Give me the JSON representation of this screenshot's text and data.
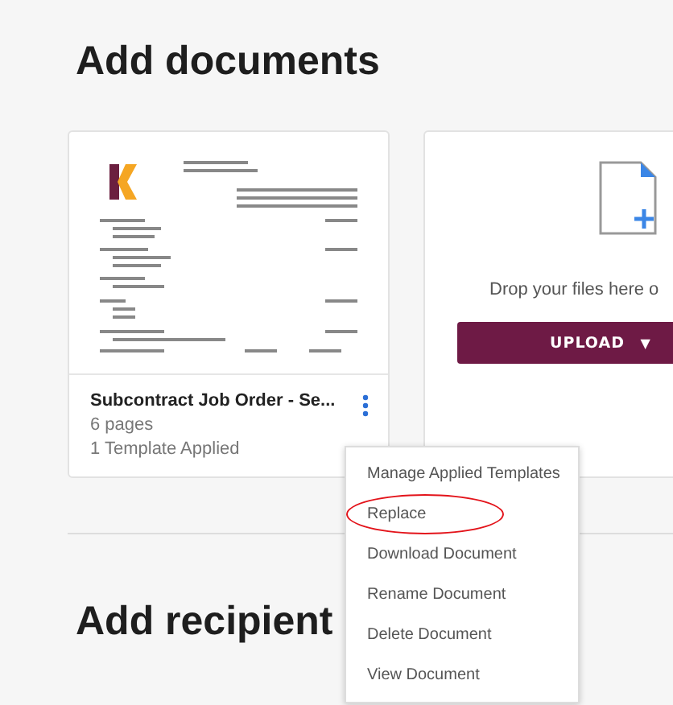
{
  "heading": "Add documents",
  "documents": [
    {
      "title": "Subcontract Job Order - Se...",
      "pages": "6 pages",
      "templates": "1 Template Applied"
    }
  ],
  "upload": {
    "prompt": "Drop your files here o",
    "button": "UPLOAD",
    "caret": "▼"
  },
  "menu": {
    "items": [
      {
        "label": "Manage Applied Templates",
        "circled": false
      },
      {
        "label": "Replace",
        "circled": true
      },
      {
        "label": "Download Document",
        "circled": false
      },
      {
        "label": "Rename Document",
        "circled": false
      },
      {
        "label": "Delete Document",
        "circled": false
      },
      {
        "label": "View Document",
        "circled": false
      }
    ]
  },
  "next_heading": "Add recipient"
}
